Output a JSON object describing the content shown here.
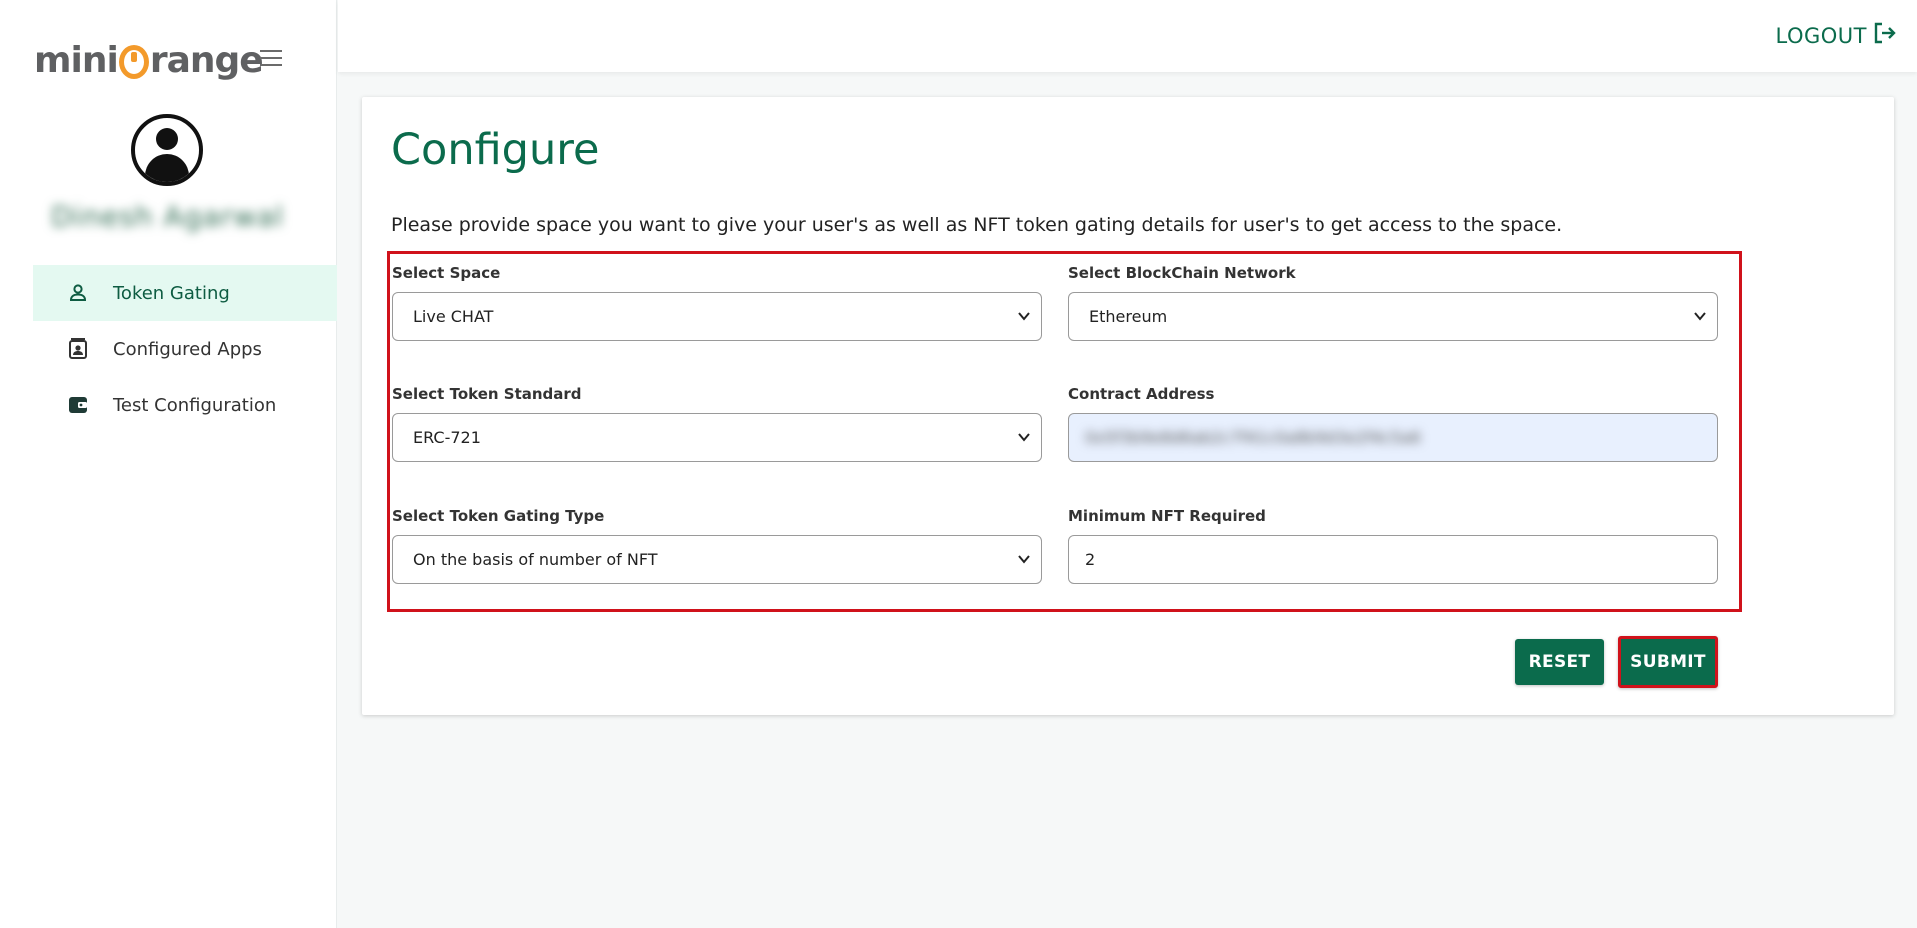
{
  "brand": {
    "prefix": "mini",
    "suffix": "range"
  },
  "user": {
    "name": "Dinesh Agarwal"
  },
  "sidebar": {
    "items": [
      {
        "label": "Token Gating",
        "icon": "person-icon",
        "active": true
      },
      {
        "label": "Configured Apps",
        "icon": "contact-card-icon",
        "active": false
      },
      {
        "label": "Test Configuration",
        "icon": "wallet-icon",
        "active": false
      }
    ]
  },
  "header": {
    "logout_label": "LOGOUT"
  },
  "main": {
    "title": "Configure",
    "description": "Please provide space you want to give your user's as well as NFT token gating details for user's to get access to the space.",
    "fields": {
      "space": {
        "label": "Select Space",
        "value": "Live CHAT"
      },
      "network": {
        "label": "Select BlockChain Network",
        "value": "Ethereum"
      },
      "token_standard": {
        "label": "Select Token Standard",
        "value": "ERC-721"
      },
      "contract_address": {
        "label": "Contract Address",
        "value": "0x5f3b9e8d6ab2c7f41c0a8b9d3e2f4c5a6"
      },
      "gating_type": {
        "label": "Select Token Gating Type",
        "value": "On the basis of number of NFT"
      },
      "min_nft": {
        "label": "Minimum NFT Required",
        "value": "2"
      }
    },
    "buttons": {
      "reset": "RESET",
      "submit": "SUBMIT"
    }
  },
  "colors": {
    "brand_green": "#0b6b4c",
    "highlight_red": "#d0121b",
    "brand_orange": "#f39a2b",
    "active_nav_bg": "#e4f9f1"
  }
}
